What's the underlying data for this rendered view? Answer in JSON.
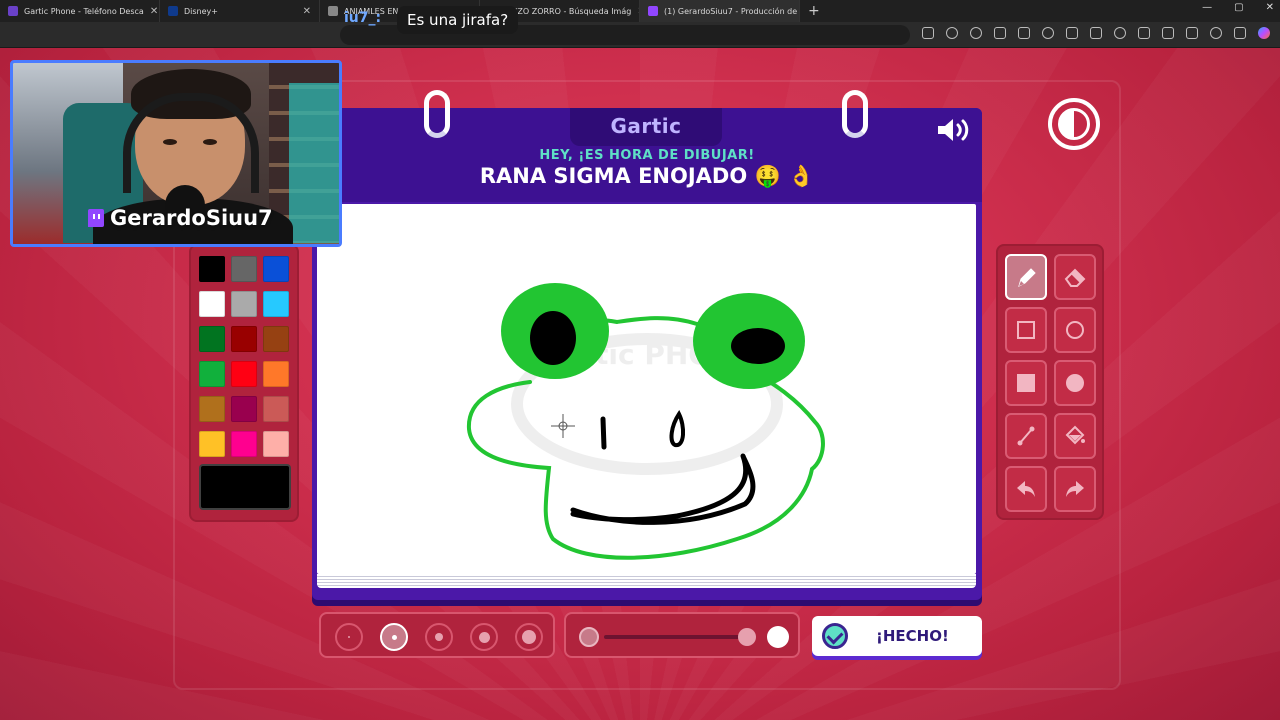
{
  "browser": {
    "tabs": [
      {
        "label": "Gartic Phone - Teléfono Desca",
        "active": false
      },
      {
        "label": "Disney+",
        "active": false
      },
      {
        "label": "ANIAMLES EN VIDEOJUEGOS - B",
        "active": false
      },
      {
        "label": "ARIZO ZORRO - Búsqueda Imág",
        "active": false
      },
      {
        "label": "(1) GerardoSiuu7 - Producción de",
        "active": true
      }
    ],
    "new_tab": "+",
    "window_controls": [
      "—",
      "▢",
      "✕"
    ]
  },
  "overlay": {
    "partial_name": "iu7_:",
    "subtitle": "Es una jirafa?",
    "streamer_name": "GerardoSiuu7"
  },
  "game": {
    "logo": "Gartic",
    "kicker": "HEY, ¡ES HORA DE DIBUJAR!",
    "prompt": "RANA SIGMA ENOJADO 🤑 👌",
    "watermark": "Gartic PHONE",
    "done_label": "¡HECHO!"
  },
  "palette": {
    "colors": [
      "#000000",
      "#666666",
      "#0a50d8",
      "#ffffff",
      "#aaaaaa",
      "#26c9ff",
      "#017420",
      "#990000",
      "#964112",
      "#11b03c",
      "#ff0013",
      "#ff7829",
      "#b0701c",
      "#99004e",
      "#cb5a57",
      "#ffc126",
      "#ff008f",
      "#feafa8"
    ],
    "current": "#000000"
  },
  "tools": [
    {
      "name": "pencil-tool",
      "icon": "pencil-icon",
      "selected": true
    },
    {
      "name": "eraser-tool",
      "icon": "eraser-icon",
      "selected": false
    },
    {
      "name": "rectangle-outline-tool",
      "icon": "rectangle-outline-icon",
      "selected": false
    },
    {
      "name": "ellipse-outline-tool",
      "icon": "ellipse-outline-icon",
      "selected": false
    },
    {
      "name": "rectangle-fill-tool",
      "icon": "rectangle-fill-icon",
      "selected": false
    },
    {
      "name": "ellipse-fill-tool",
      "icon": "ellipse-fill-icon",
      "selected": false
    },
    {
      "name": "line-tool",
      "icon": "line-icon",
      "selected": false
    },
    {
      "name": "bucket-tool",
      "icon": "bucket-icon",
      "selected": false
    },
    {
      "name": "undo-tool",
      "icon": "undo-icon",
      "selected": false
    },
    {
      "name": "redo-tool",
      "icon": "redo-icon",
      "selected": false
    }
  ],
  "brush_sizes": {
    "count": 5,
    "selected_index": 1
  },
  "opacity": {
    "value": 1.0
  },
  "colors": {
    "accent_purple": "#4b18a8",
    "accent_teal": "#5fe0c6",
    "frog_green": "#22c532",
    "background_red": "#cf2f4e"
  }
}
